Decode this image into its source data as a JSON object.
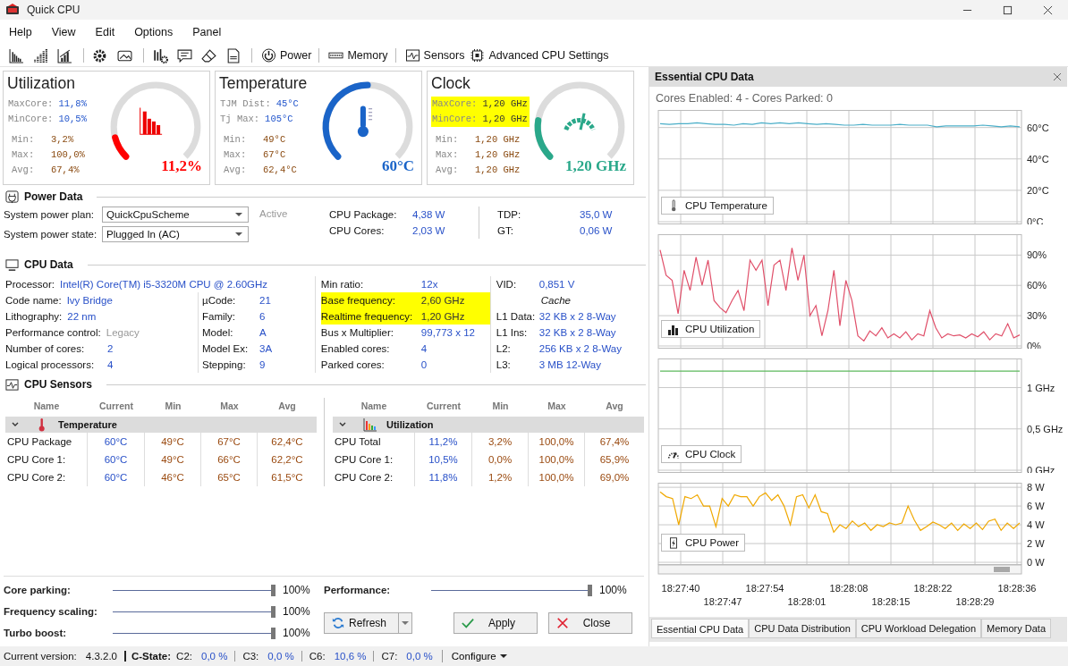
{
  "window": {
    "title": "Quick CPU"
  },
  "menu": [
    "Help",
    "View",
    "Edit",
    "Options",
    "Panel"
  ],
  "toolbar": [
    "Power",
    "Memory",
    "Sensors",
    "Advanced CPU Settings"
  ],
  "gauges": [
    {
      "kind": "utilization",
      "title": "Utilization",
      "core_stats": [
        {
          "label": "MaxCore:",
          "value": "11,8%",
          "highlighted": false
        },
        {
          "label": "MinCore:",
          "value": "10,5%",
          "highlighted": false
        }
      ],
      "stats": [
        {
          "label": "Min:",
          "value": "3,2%"
        },
        {
          "label": "Max:",
          "value": "100,0%"
        },
        {
          "label": "Avg:",
          "value": "67,4%"
        }
      ],
      "reading": "11,2%",
      "level": 0.112,
      "color": "#ff0000"
    },
    {
      "kind": "temperature",
      "title": "Temperature",
      "core_stats": [
        {
          "label": "TJM Dist:",
          "value": "45°C",
          "highlighted": false
        },
        {
          "label": "Tj Max:",
          "value": "105°C",
          "highlighted": false
        }
      ],
      "stats": [
        {
          "label": "Min:",
          "value": "49°C"
        },
        {
          "label": "Max:",
          "value": "67°C"
        },
        {
          "label": "Avg:",
          "value": "62,4°C"
        }
      ],
      "reading": "60°C",
      "level": 0.5,
      "color": "#1a64c8"
    },
    {
      "kind": "clock",
      "title": "Clock",
      "core_stats": [
        {
          "label": "MaxCore:",
          "value": "1,20 GHz",
          "highlighted": true
        },
        {
          "label": "MinCore:",
          "value": "1,20 GHz",
          "highlighted": true
        }
      ],
      "stats": [
        {
          "label": "Min:",
          "value": "1,20 GHz"
        },
        {
          "label": "Max:",
          "value": "1,20 GHz"
        },
        {
          "label": "Avg:",
          "value": "1,20 GHz"
        }
      ],
      "reading": "1,20 GHz",
      "level": 0.2,
      "color": "#2aa88a"
    }
  ],
  "power_data": {
    "title": "Power Data",
    "plan_label": "System power plan:",
    "plan": "QuickCpuScheme",
    "state_label": "System power state:",
    "state": "Plugged In (AC)",
    "status": "Active",
    "stats": [
      {
        "label": "CPU Package:",
        "value": "4,38 W"
      },
      {
        "label": "CPU Cores:",
        "value": "2,03 W"
      },
      {
        "label": "TDP:",
        "value": "35,0 W"
      },
      {
        "label": "GT:",
        "value": "0,06 W"
      }
    ]
  },
  "cpu_data": {
    "title": "CPU Data",
    "columns": [
      [
        {
          "kind": "pair",
          "label": "Processor:",
          "value": "Intel(R) Core(TM) i5-3320M CPU @ 2.60GHz"
        },
        {
          "kind": "pair",
          "label": "Code name:",
          "value": "Ivy Bridge"
        },
        {
          "kind": "pair",
          "label": "Lithography:",
          "value": "22 nm"
        },
        {
          "kind": "dim",
          "label": "Performance control:",
          "value": "Legacy"
        },
        {
          "kind": "pair",
          "label": "Number of cores:",
          "value": "2"
        },
        {
          "kind": "pair",
          "label": "Logical processors:",
          "value": "4"
        }
      ],
      [
        {
          "kind": "pair",
          "label": "µCode:",
          "value": "21"
        },
        {
          "kind": "pair",
          "label": "Family:",
          "value": "6"
        },
        {
          "kind": "pair",
          "label": "Model:",
          "value": "A"
        },
        {
          "kind": "pair",
          "label": "Model Ex:",
          "value": "3A"
        },
        {
          "kind": "pair",
          "label": "Stepping:",
          "value": "9"
        }
      ],
      [
        {
          "kind": "pair",
          "label": "Min ratio:",
          "value": "12x",
          "highlighted": false
        },
        {
          "kind": "pair",
          "label": "Base frequency:",
          "value": "2,60 GHz",
          "highlighted": true
        },
        {
          "kind": "pair",
          "label": "Realtime frequency:",
          "value": "1,20 GHz",
          "highlighted": true
        },
        {
          "kind": "pair",
          "label": "Bus x Multiplier:",
          "value": "99,773 x 12",
          "highlighted": false
        },
        {
          "kind": "pair",
          "label": "Enabled cores:",
          "value": "4",
          "highlighted": false
        },
        {
          "kind": "pair",
          "label": "Parked cores:",
          "value": "0",
          "highlighted": false
        }
      ],
      [
        {
          "kind": "pair",
          "label": "VID:",
          "value": "0,851 V"
        },
        {
          "kind": "heading",
          "label": "Cache"
        },
        {
          "kind": "pair",
          "label": "L1 Data:",
          "value": "32 KB x 2  8-Way"
        },
        {
          "kind": "pair",
          "label": "L1 Ins:",
          "value": "32 KB x 2  8-Way"
        },
        {
          "kind": "pair",
          "label": "L2:",
          "value": "256 KB x 2  8-Way"
        },
        {
          "kind": "pair",
          "label": "L3:",
          "value": "3 MB  12-Way"
        }
      ]
    ]
  },
  "sensors": {
    "title": "CPU Sensors",
    "tables": [
      {
        "kind": "temperature",
        "columns": [
          "Name",
          "Current",
          "Min",
          "Max",
          "Avg"
        ],
        "group": {
          "label": "Temperature",
          "expanded": true
        },
        "rows": [
          [
            "CPU Package",
            "60°C",
            "49°C",
            "67°C",
            "62,4°C"
          ],
          [
            "CPU Core 1:",
            "60°C",
            "49°C",
            "66°C",
            "62,2°C"
          ],
          [
            "CPU Core 2:",
            "60°C",
            "46°C",
            "65°C",
            "61,5°C"
          ]
        ]
      },
      {
        "kind": "utilization",
        "columns": [
          "Name",
          "Current",
          "Min",
          "Max",
          "Avg"
        ],
        "group": {
          "label": "Utilization",
          "expanded": true
        },
        "rows": [
          [
            "CPU Total",
            "11,2%",
            "3,2%",
            "100,0%",
            "67,4%"
          ],
          [
            "CPU Core 1:",
            "10,5%",
            "0,0%",
            "100,0%",
            "65,9%"
          ],
          [
            "CPU Core 2:",
            "11,8%",
            "1,2%",
            "100,0%",
            "69,0%"
          ]
        ]
      }
    ]
  },
  "sliders": [
    {
      "label": "Core parking:",
      "level": 1,
      "reading": "100%"
    },
    {
      "label": "Frequency scaling:",
      "level": 1,
      "reading": "100%"
    },
    {
      "label": "Turbo boost:",
      "level": 1,
      "reading": "100%"
    }
  ],
  "performance": {
    "label": "Performance:",
    "level": 1,
    "reading": "100%"
  },
  "buttons": {
    "refresh": "Refresh",
    "apply": "Apply",
    "close": "Close"
  },
  "panel": {
    "title": "Essential CPU Data",
    "summary": "Cores Enabled: 4 - Cores Parked: 0",
    "charts": [
      {
        "kind": "temperature",
        "chart_data": {
          "type": "line",
          "grid": true,
          "ylim": [
            0,
            69.5
          ],
          "yticks": [
            {
              "value": 0,
              "label": "0°C"
            },
            {
              "value": 20,
              "label": "20°C"
            },
            {
              "value": 40,
              "label": "40°C"
            },
            {
              "value": 60,
              "label": "60°C"
            }
          ],
          "series": [
            {
              "name": "CPU Temperature",
              "color": "#4aaec8",
              "values": [
                62.5,
                62,
                62.5,
                62.5,
                63,
                62.5,
                62,
                62,
                61.5,
                62.5,
                62,
                63,
                62.5,
                63,
                62.5,
                63,
                62.5,
                62,
                62.5,
                62,
                61.5,
                61.5,
                62,
                61.5,
                61.5,
                61.5,
                62,
                61.5,
                61.5,
                61.5,
                60.5,
                61,
                61,
                61,
                61,
                61.5,
                61,
                60.5,
                61,
                60.5
              ]
            }
          ]
        }
      },
      {
        "kind": "utilization",
        "chart_data": {
          "type": "line",
          "grid": true,
          "ylim": [
            0,
            108
          ],
          "yticks": [
            {
              "value": 0,
              "label": "0%"
            },
            {
              "value": 30,
              "label": "30%"
            },
            {
              "value": 60,
              "label": "60%"
            },
            {
              "value": 90,
              "label": "90%"
            }
          ],
          "series": [
            {
              "name": "CPU Utilization",
              "color": "#e0506a",
              "values": [
                95,
                70,
                65,
                32,
                75,
                55,
                88,
                60,
                85,
                45,
                38,
                33,
                45,
                55,
                35,
                85,
                75,
                85,
                40,
                80,
                85,
                55,
                97,
                65,
                90,
                30,
                40,
                10,
                35,
                75,
                20,
                65,
                45,
                10,
                5,
                15,
                10,
                18,
                8,
                12,
                8,
                14,
                6,
                12,
                10,
                35,
                18,
                8,
                12,
                10,
                11,
                8,
                12,
                9,
                14,
                6,
                12,
                10,
                22,
                8,
                11
              ]
            }
          ]
        }
      },
      {
        "kind": "clock",
        "chart_data": {
          "type": "line",
          "grid": true,
          "ylim": [
            0,
            1.32
          ],
          "yticks": [
            {
              "value": 0,
              "label": "0 GHz"
            },
            {
              "value": 0.5,
              "label": "0,5 GHz"
            },
            {
              "value": 1,
              "label": "1 GHz"
            }
          ],
          "series": [
            {
              "name": "CPU Clock",
              "color": "#5cb85c",
              "values": [
                1.2,
                1.2,
                1.2,
                1.2,
                1.2,
                1.2,
                1.2,
                1.2,
                1.2,
                1.2
              ]
            }
          ]
        }
      },
      {
        "kind": "power",
        "chart_data": {
          "type": "line",
          "grid": true,
          "ylim": [
            0,
            8.2
          ],
          "yticks": [
            {
              "value": 0,
              "label": "0 W"
            },
            {
              "value": 2,
              "label": "2 W"
            },
            {
              "value": 4,
              "label": "4 W"
            },
            {
              "value": 6,
              "label": "6 W"
            },
            {
              "value": 8,
              "label": "8 W"
            }
          ],
          "series": [
            {
              "name": "CPU Power",
              "color": "#f0a800",
              "values": [
                7.5,
                7,
                6.8,
                4,
                7,
                6.8,
                7.2,
                6,
                6,
                3.8,
                6.8,
                6,
                7.2,
                7,
                7,
                6,
                7,
                7.4,
                6.6,
                7.2,
                6,
                4,
                7,
                7.2,
                5.8,
                7.2,
                5.4,
                5.2,
                3.2,
                4,
                3.6,
                4.4,
                3.8,
                4.2,
                3.4,
                4,
                3.8,
                4.2,
                4,
                4.2,
                6,
                4.5,
                3.4,
                3.8,
                4.3,
                4,
                3.6,
                4.2,
                3.4,
                4.1,
                3.6,
                4.2,
                3.5,
                4.4,
                4.6,
                3.4,
                4.2,
                3.6,
                4.2
              ]
            }
          ]
        }
      }
    ],
    "time_labels": [
      "18:27:40",
      "18:27:47",
      "18:27:54",
      "18:28:01",
      "18:28:08",
      "18:28:15",
      "18:28:22",
      "18:28:29",
      "18:28:36"
    ],
    "tabs": [
      {
        "label": "Essential CPU Data",
        "selected": true
      },
      {
        "label": "CPU Data Distribution",
        "selected": false
      },
      {
        "label": "CPU Workload Delegation",
        "selected": false
      },
      {
        "label": "Memory Data",
        "selected": false
      }
    ]
  },
  "status_bar": {
    "version_label": "Current version:",
    "version": "4.3.2.0",
    "cstate_label": "C-State:",
    "cstates": [
      {
        "label": "C2:",
        "value": "0,0 %"
      },
      {
        "label": "C3:",
        "value": "0,0 %"
      },
      {
        "label": "C6:",
        "value": "10,6 %"
      },
      {
        "label": "C7:",
        "value": "0,0 %"
      }
    ],
    "configure": "Configure"
  }
}
